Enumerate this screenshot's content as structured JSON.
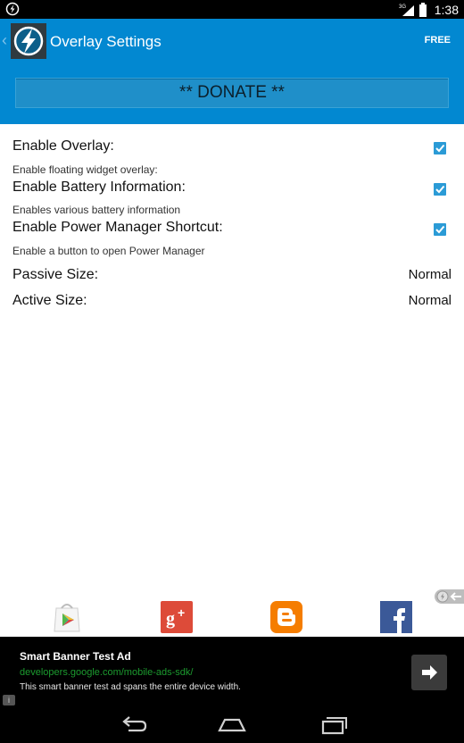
{
  "status_bar": {
    "time": "1:38",
    "network": "3G",
    "icons": [
      "app-notification-icon",
      "signal-icon",
      "battery-icon"
    ]
  },
  "header": {
    "back_icon": "chevron-left-icon",
    "app_icon": "lightning-bolt-icon",
    "title": "Overlay Settings",
    "badge": "FREE",
    "donate_label": "** DONATE **",
    "color": "#0288d1"
  },
  "settings": [
    {
      "title": "Enable Overlay:",
      "summary": "Enable floating widget overlay:",
      "checked": true
    },
    {
      "title": "Enable Battery Information:",
      "summary": "Enables various battery information",
      "checked": true
    },
    {
      "title": "Enable Power Manager Shortcut:",
      "summary": "Enable a button to open Power Manager",
      "checked": true
    }
  ],
  "size_settings": [
    {
      "title": "Passive Size:",
      "value": "Normal"
    },
    {
      "title": "Active Size:",
      "value": "Normal"
    }
  ],
  "social": [
    "play-store-icon",
    "google-plus-icon",
    "blogger-icon",
    "facebook-icon"
  ],
  "ad": {
    "title": "Smart Banner Test Ad",
    "url": "developers.google.com/mobile-ads-sdk/",
    "description": "This smart banner test ad spans the entire device width.",
    "info": "i",
    "arrow_icon": "arrow-right-icon"
  },
  "nav": [
    "back-nav-icon",
    "home-nav-icon",
    "recents-nav-icon"
  ]
}
